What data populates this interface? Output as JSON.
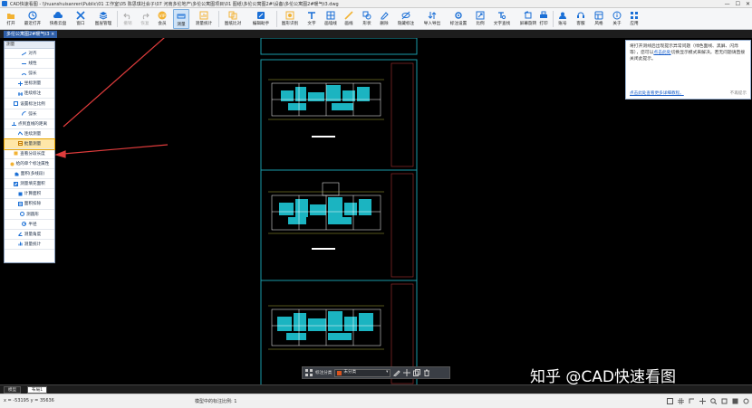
{
  "window": {
    "title": "CAD快速看图 - \\\\huanshuisanren\\Public\\01 工作室\\05 陈思琪社会子\\07 河南多伦地产\\多伦公寓图项目\\01 图纸\\多伦公寓图2#\\设备\\多伦公寓图2#暖气t3.dwg",
    "minimize": "—",
    "maximize": "☐",
    "close": "✕"
  },
  "toolbar": {
    "items": [
      {
        "label": "打开",
        "icon": "folder-open-icon"
      },
      {
        "label": "最近打开",
        "icon": "recent-icon"
      },
      {
        "label": "快看云盘",
        "icon": "cloud-icon"
      },
      {
        "label": "窗口",
        "icon": "window-icon"
      },
      {
        "label": "图层管理",
        "icon": "layers-icon"
      },
      {
        "label": "撤销",
        "icon": "undo-icon"
      },
      {
        "label": "恢复",
        "icon": "redo-icon"
      },
      {
        "label": "会员",
        "icon": "vip-icon"
      },
      {
        "label": "测量",
        "icon": "measure-icon"
      },
      {
        "label": "测量统计",
        "icon": "measure-stats-icon"
      },
      {
        "label": "图纸比对",
        "icon": "compare-icon"
      },
      {
        "label": "编辑助手",
        "icon": "edit-helper-icon"
      },
      {
        "label": "图形识别",
        "icon": "shape-recognize-icon"
      },
      {
        "label": "文字",
        "icon": "text-icon"
      },
      {
        "label": "画墙线",
        "icon": "wall-line-icon"
      },
      {
        "label": "画线",
        "icon": "line-icon"
      },
      {
        "label": "形状",
        "icon": "shape-icon"
      },
      {
        "label": "删除",
        "icon": "delete-icon"
      },
      {
        "label": "隐藏标注",
        "icon": "hide-annotation-icon"
      },
      {
        "label": "导入导出",
        "icon": "import-export-icon"
      },
      {
        "label": "标注设置",
        "icon": "annotation-settings-icon"
      },
      {
        "label": "比例",
        "icon": "scale-icon"
      },
      {
        "label": "文字查找",
        "icon": "text-search-icon"
      },
      {
        "label": "屏幕旋转",
        "icon": "rotate-icon"
      },
      {
        "label": "打印",
        "icon": "print-icon"
      },
      {
        "label": "账号",
        "icon": "account-icon"
      },
      {
        "label": "客服",
        "icon": "support-icon"
      },
      {
        "label": "风格",
        "icon": "style-icon"
      },
      {
        "label": "关于",
        "icon": "about-icon"
      },
      {
        "label": "应用",
        "icon": "apps-icon"
      }
    ]
  },
  "file_tab": {
    "label": "多伦公寓图2#暖气t3 ×"
  },
  "measure_panel": {
    "header": "测量",
    "items": [
      {
        "label": "对齐",
        "icon": "align-icon"
      },
      {
        "label": "线性",
        "icon": "linear-icon"
      },
      {
        "label": "弧长",
        "icon": "arc-length-icon"
      },
      {
        "label": "坐标测量",
        "icon": "coordinate-icon"
      },
      {
        "label": "连续标注",
        "icon": "continuous-dim-icon"
      },
      {
        "label": "设置标注比例",
        "icon": "dim-scale-icon"
      },
      {
        "label": "弧长",
        "icon": "arc-icon"
      },
      {
        "label": "点到直线的距离",
        "icon": "point-line-icon"
      },
      {
        "label": "连续测量",
        "icon": "continuous-measure-icon"
      },
      {
        "label": "批量测量",
        "icon": "batch-measure-icon"
      },
      {
        "label": "查看分段长度",
        "icon": "segment-length-icon"
      },
      {
        "label": "给的单个标注属性",
        "icon": "annotation-prop-icon"
      },
      {
        "label": "面积(多线段)",
        "icon": "area-polyline-icon"
      },
      {
        "label": "测量填充面积",
        "icon": "hatch-area-icon"
      },
      {
        "label": "计算面积",
        "icon": "calc-area-icon"
      },
      {
        "label": "面积扣除",
        "icon": "area-deduct-icon"
      },
      {
        "label": "测圆形",
        "icon": "circle-icon"
      },
      {
        "label": "半径",
        "icon": "radius-icon"
      },
      {
        "label": "测量角度",
        "icon": "angle-icon"
      },
      {
        "label": "测量统计",
        "icon": "stats-icon"
      }
    ]
  },
  "notice": {
    "text_a": "将打开测线后出现提示异常问题（绿色面线、黑屏、闪烁等），您可以",
    "link_a": "点击此处",
    "text_b": "切换显示模式来解决。若无问题请直接关闭此提示。",
    "link": "点击此处",
    "link_suffix": "查看更多详细教程。",
    "close_label": "不再提示"
  },
  "float_bar": {
    "label": "标注分类",
    "select_value": "未分类",
    "arrow": "▾"
  },
  "layout_tabs": [
    {
      "label": "模型"
    },
    {
      "label": "布局1"
    }
  ],
  "status": {
    "coords": "x = -53195  y = 35636",
    "scale": "模型中的标注比例: 1"
  },
  "watermark": "知乎 @CAD快速看图",
  "colors": {
    "accent": "#1a6fd6",
    "sheet_border": "#1a9aa8",
    "highlight": "#ffe7a8",
    "arrow": "#e03c3c"
  }
}
